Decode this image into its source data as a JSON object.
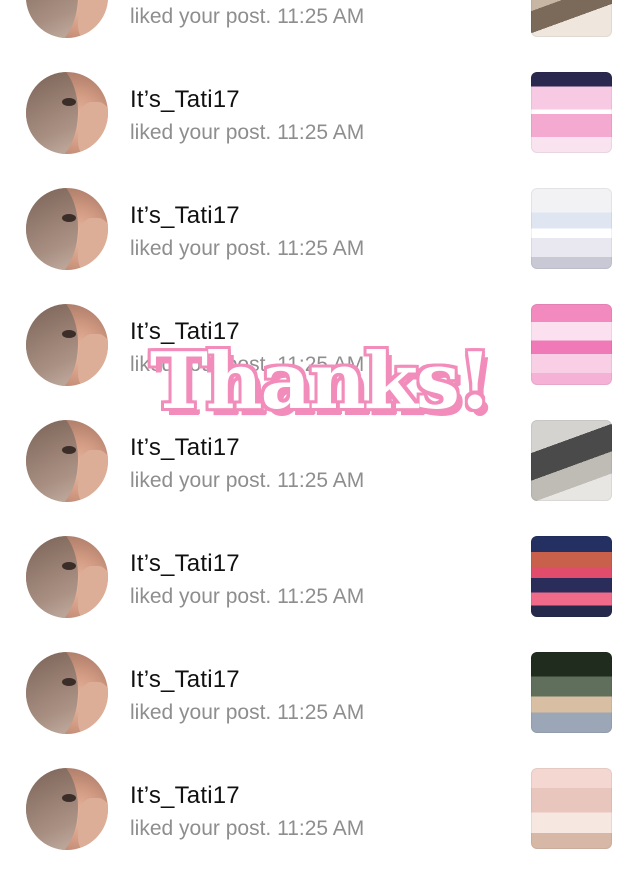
{
  "notifications": [
    {
      "username": "",
      "action": "liked your post. 11:25 AM"
    },
    {
      "username": "It’s_Tati17",
      "action": "liked your post. 11:25 AM"
    },
    {
      "username": "It’s_Tati17",
      "action": "liked your post. 11:25 AM"
    },
    {
      "username": "It’s_Tati17",
      "action": "liked your post. 11:25 AM"
    },
    {
      "username": "It’s_Tati17",
      "action": "liked your post. 11:25 AM"
    },
    {
      "username": "It’s_Tati17",
      "action": "liked your post. 11:25 AM"
    },
    {
      "username": "It’s_Tati17",
      "action": "liked your post. 11:25 AM"
    },
    {
      "username": "It’s_Tati17",
      "action": "liked your post. 11:25 AM"
    }
  ],
  "overlay": {
    "text": "Thanks!",
    "color": "#f28cbb"
  },
  "colors": {
    "name": "#111111",
    "meta": "#8e8e8e",
    "background": "#ffffff"
  }
}
